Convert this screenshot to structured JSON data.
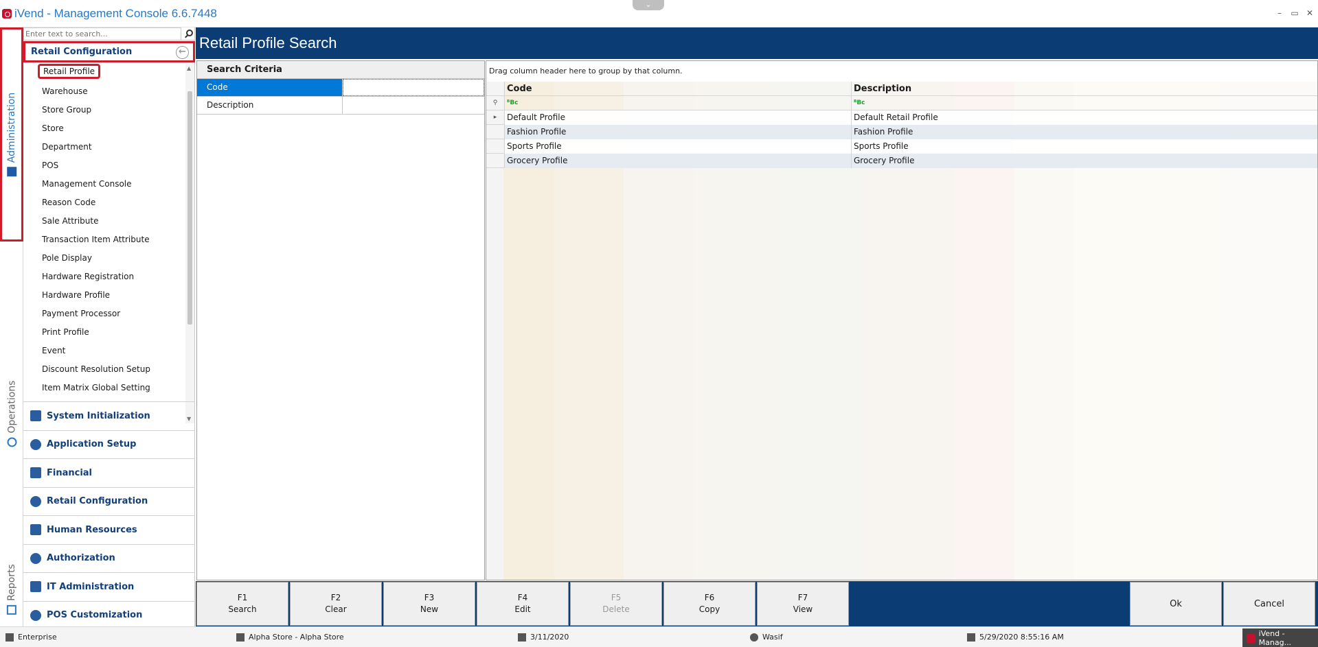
{
  "window": {
    "title": "iVend - Management Console  6.6.7448",
    "controls": [
      "–",
      "▭",
      "✕"
    ],
    "collapse_glyph": "⌄"
  },
  "vertical_tabs": {
    "administration": "Administration",
    "operations": "Operations",
    "reports": "Reports"
  },
  "nav": {
    "search_placeholder": "Enter text to search...",
    "section_title": "Retail Configuration",
    "back_glyph": "←",
    "items": [
      "Retail Profile",
      "Warehouse",
      "Store Group",
      "Store",
      "Department",
      "POS",
      "Management Console",
      "Reason Code",
      "Sale Attribute",
      "Transaction Item Attribute",
      "Pole Display",
      "Hardware Registration",
      "Hardware Profile",
      "Payment Processor",
      "Print Profile",
      "Event",
      "Discount Resolution Setup",
      "Item Matrix Global Setting"
    ],
    "groups": [
      {
        "label": "System Initialization",
        "icon": "hourglass-icon"
      },
      {
        "label": "Application Setup",
        "icon": "window-icon"
      },
      {
        "label": "Financial",
        "icon": "bank-icon"
      },
      {
        "label": "Retail Configuration",
        "icon": "gears-icon"
      },
      {
        "label": "Human Resources",
        "icon": "user-search-icon"
      },
      {
        "label": "Authorization",
        "icon": "shield-icon"
      },
      {
        "label": "IT Administration",
        "icon": "admin-user-icon"
      },
      {
        "label": "POS Customization",
        "icon": "pos-gear-icon"
      }
    ]
  },
  "main": {
    "title": "Retail Profile Search",
    "criteria": {
      "header": "Search Criteria",
      "rows": [
        {
          "label": "Code",
          "value": ""
        },
        {
          "label": "Description",
          "value": ""
        }
      ]
    },
    "grid": {
      "group_hint": "Drag column header here to group by that column.",
      "columns": [
        "Code",
        "Description"
      ],
      "filter_glyph": "ᴮBc",
      "rows": [
        {
          "code": "Default Profile",
          "description": "Default Retail Profile"
        },
        {
          "code": "Fashion Profile",
          "description": "Fashion Profile"
        },
        {
          "code": "Sports Profile",
          "description": "Sports Profile"
        },
        {
          "code": "Grocery Profile",
          "description": "Grocery Profile"
        }
      ]
    }
  },
  "function_keys": [
    {
      "key": "F1",
      "label": "Search",
      "enabled": true
    },
    {
      "key": "F2",
      "label": "Clear",
      "enabled": true
    },
    {
      "key": "F3",
      "label": "New",
      "enabled": true
    },
    {
      "key": "F4",
      "label": "Edit",
      "enabled": true
    },
    {
      "key": "F5",
      "label": "Delete",
      "enabled": false
    },
    {
      "key": "F6",
      "label": "Copy",
      "enabled": true
    },
    {
      "key": "F7",
      "label": "View",
      "enabled": true
    }
  ],
  "actions": {
    "ok": "Ok",
    "cancel": "Cancel"
  },
  "status": {
    "edition": "Enterprise",
    "store": "Alpha Store - Alpha Store",
    "business_date": "3/11/2020",
    "user": "Wasif",
    "login_time": "5/29/2020 8:55:16 AM",
    "taskbar": "iVend - Manag..."
  },
  "colors": {
    "header_blue": "#0b3c73",
    "accent_blue": "#2a78c2",
    "highlight_red": "#d11a2a",
    "selection_blue": "#0078d7"
  }
}
